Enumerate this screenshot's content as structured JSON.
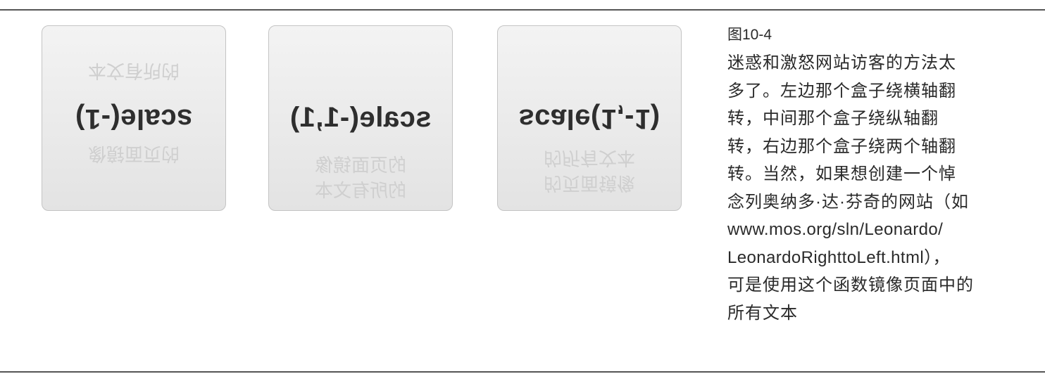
{
  "boxes": [
    {
      "label": "scale(-1)",
      "ghost_top": "的页面镜像",
      "ghost_bottom": "的所有文本"
    },
    {
      "label": "scale(-1,1)",
      "ghost_top": "的页面镜像",
      "ghost_bottom": "的所有文本"
    },
    {
      "label": "scale(1,-1)",
      "ghost_top": "的页面镜像",
      "ghost_bottom": "的所有文本"
    }
  ],
  "caption": {
    "figure_number": "图10-4",
    "lines": [
      "迷惑和激怒网站访客的方法太",
      "多了。左边那个盒子绕横轴翻",
      "转，中间那个盒子绕纵轴翻",
      "转，右边那个盒子绕两个轴翻",
      "转。当然，如果想创建一个悼",
      "念列奥纳多·达·芬奇的网站（如",
      "www.mos.org/sln/Leonardo/",
      "LeonardoRighttoLeft.html），",
      "可是使用这个函数镜像页面中的",
      "所有文本"
    ]
  }
}
